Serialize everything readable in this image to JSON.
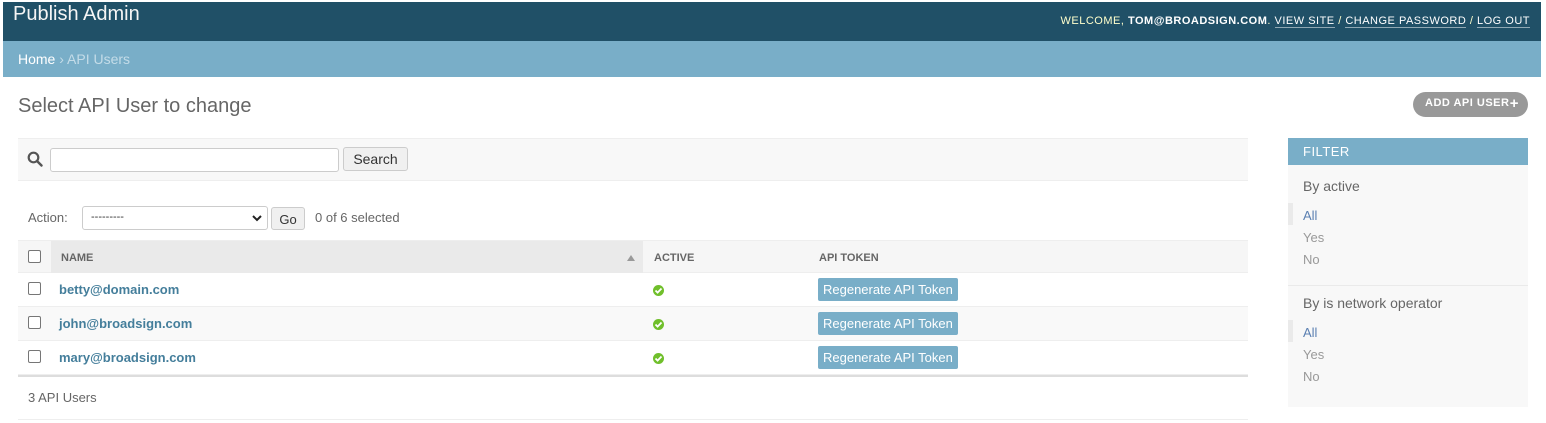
{
  "header": {
    "site_name": "Publish Admin",
    "welcome_prefix": "WELCOME, ",
    "username": "TOM@BROADSIGN.COM",
    "view_site": "VIEW SITE",
    "change_password": "CHANGE PASSWORD",
    "log_out": "LOG OUT",
    "separator": " / "
  },
  "breadcrumbs": {
    "home": "Home",
    "separator": " › ",
    "current": "API Users"
  },
  "page": {
    "title": "Select API User to change",
    "add_button": "ADD API USER"
  },
  "search": {
    "value": "",
    "button": "Search"
  },
  "actions": {
    "label": "Action:",
    "selected_option": "---------",
    "go": "Go",
    "counter": "0 of 6 selected"
  },
  "table": {
    "columns": [
      "NAME",
      "ACTIVE",
      "API TOKEN"
    ],
    "rows": [
      {
        "name": "betty@domain.com",
        "active": true,
        "token_button": "Regenerate API Token"
      },
      {
        "name": "john@broadsign.com",
        "active": true,
        "token_button": "Regenerate API Token"
      },
      {
        "name": "mary@broadsign.com",
        "active": true,
        "token_button": "Regenerate API Token"
      }
    ]
  },
  "paginator": "3 API Users",
  "filter": {
    "title": "FILTER",
    "groups": [
      {
        "title": "By active",
        "options": [
          "All",
          "Yes",
          "No"
        ],
        "selected": "All"
      },
      {
        "title": "By is network operator",
        "options": [
          "All",
          "Yes",
          "No"
        ],
        "selected": "All"
      }
    ]
  },
  "colors": {
    "header_bg": "#205067",
    "breadcrumb_bg": "#79aec8",
    "link": "#447e9b",
    "active_green": "#70bf2b"
  }
}
